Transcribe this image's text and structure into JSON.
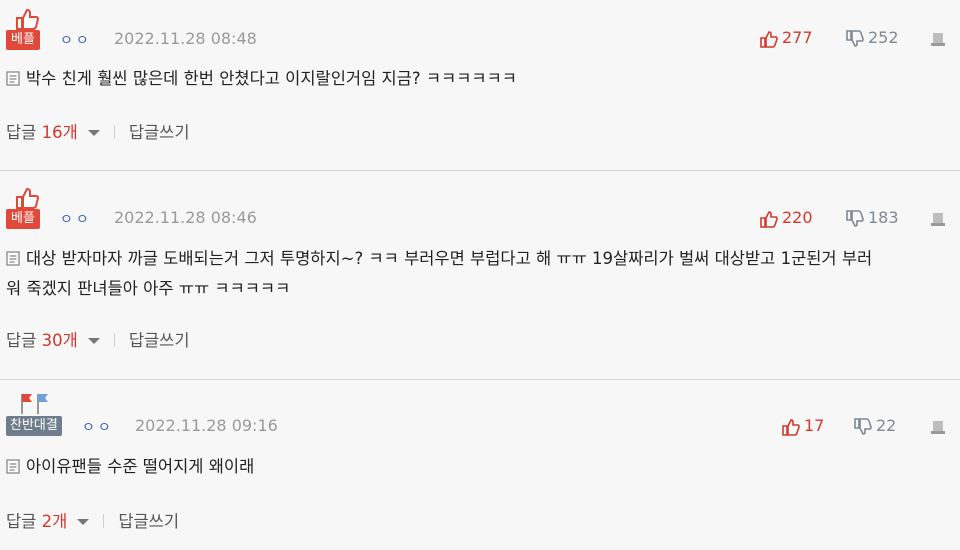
{
  "comments": [
    {
      "badge": "베플",
      "nickname": "ㅇㅇ",
      "date": "2022.11.28 08:48",
      "likes": "277",
      "dislikes": "252",
      "text": "박수 친게 훨씬 많은데 한번 안쳤다고 이지랄인거임 지금? ㅋㅋㅋㅋㅋㅋ",
      "reply_label": "답글",
      "reply_count": "16개",
      "write_reply": "답글쓰기"
    },
    {
      "badge": "베플",
      "nickname": "ㅇㅇ",
      "date": "2022.11.28 08:46",
      "likes": "220",
      "dislikes": "183",
      "text_line1": "대상 받자마자 까글 도배되는거 그저 투명하지~? ㅋㅋ 부러우면 부럽다고 해 ㅠㅠ 19살짜리가 벌써 대상받고 1군된거 부러",
      "text_line2": "워 죽겠지 판녀들아 아주 ㅠㅠ ㅋㅋㅋㅋㅋ",
      "reply_label": "답글",
      "reply_count": "30개",
      "write_reply": "답글쓰기"
    },
    {
      "badge": "찬반대결",
      "nickname": "ㅇㅇ",
      "date": "2022.11.28 09:16",
      "likes": "17",
      "dislikes": "22",
      "text": "아이유팬들 수준 떨어지게 왜이래",
      "reply_label": "답글",
      "reply_count": "2개",
      "write_reply": "답글쓰기"
    }
  ],
  "colors": {
    "accent": "#d2392b",
    "badge_best": "#e1483a",
    "badge_vs": "#6f7d8c",
    "nickname": "#3b64b5"
  },
  "icons": [
    "thumbs-up-icon",
    "flag-icon",
    "like-icon",
    "dislike-icon",
    "report-icon",
    "document-icon",
    "caret-down-icon"
  ]
}
